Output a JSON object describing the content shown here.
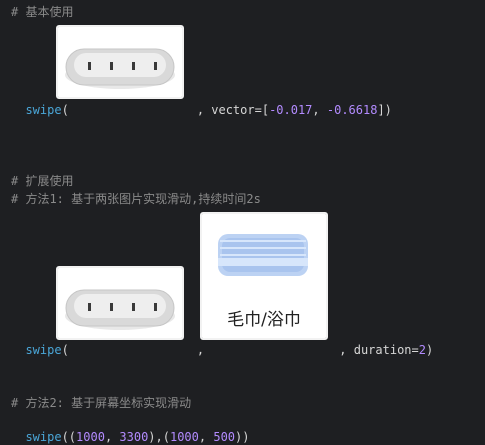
{
  "line1": {
    "text": "# 基本使用"
  },
  "line2": {
    "fn": "swipe",
    "open_paren": "(",
    "after_img": ", vector=[",
    "n1": "-0.017",
    "comma": ", ",
    "n2": "-0.6618",
    "close": "])"
  },
  "line3": {
    "text": "# 扩展使用"
  },
  "line4": {
    "text": "# 方法1: 基于两张图片实现滑动,持续时间2s"
  },
  "line5": {
    "fn": "swipe",
    "open_paren": "(",
    "between_imgs": ", ",
    "after_img2": ", duration=",
    "n": "2",
    "close": ")"
  },
  "line6": {
    "text": "# 方法2: 基于屏幕坐标实现滑动"
  },
  "line7": {
    "fn": "swipe",
    "p1": "((",
    "n1": "1000",
    "c1": ", ",
    "n2": "3300",
    "p2": "),(",
    "n3": "1000",
    "c2": ", ",
    "n4": "500",
    "p3": "))"
  },
  "towel_image": {
    "caption": "毛巾/浴巾"
  },
  "icons": [
    "soap-dish-image",
    "soap-dish-image",
    "towel-image"
  ]
}
